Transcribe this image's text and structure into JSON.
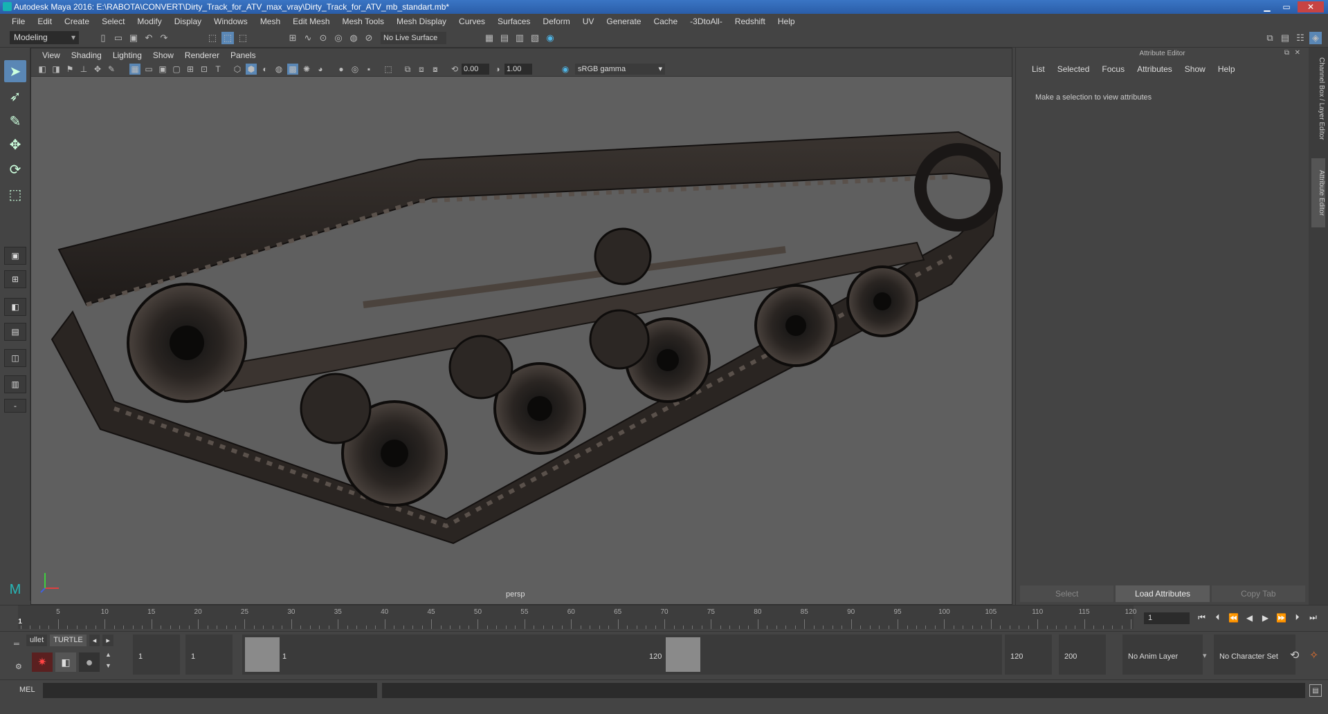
{
  "window": {
    "title": "Autodesk Maya 2016: E:\\RABOTA\\CONVERT\\Dirty_Track_for_ATV_max_vray\\Dirty_Track_for_ATV_mb_standart.mb*",
    "minimize": "▁",
    "maximize": "▭",
    "close": "✕"
  },
  "menubar": [
    "File",
    "Edit",
    "Create",
    "Select",
    "Modify",
    "Display",
    "Windows",
    "Mesh",
    "Edit Mesh",
    "Mesh Tools",
    "Mesh Display",
    "Curves",
    "Surfaces",
    "Deform",
    "UV",
    "Generate",
    "Cache",
    "-3DtoAll-",
    "Redshift",
    "Help"
  ],
  "statusline": {
    "mode": "Modeling",
    "live_surface": "No Live Surface"
  },
  "viewport": {
    "menus": [
      "View",
      "Shading",
      "Lighting",
      "Show",
      "Renderer",
      "Panels"
    ],
    "exposure": "0.00",
    "gamma": "1.00",
    "color_space": "sRGB gamma",
    "camera_label": "persp"
  },
  "attribute_editor": {
    "title": "Attribute Editor",
    "tabs": [
      "List",
      "Selected",
      "Focus",
      "Attributes",
      "Show",
      "Help"
    ],
    "message": "Make a selection to view attributes",
    "buttons": [
      "Select",
      "Load Attributes",
      "Copy Tab"
    ]
  },
  "side_tabs": [
    "Channel Box / Layer Editor",
    "Attribute Editor"
  ],
  "timeline": {
    "start_label": "1",
    "ticks": [
      5,
      10,
      15,
      20,
      25,
      30,
      35,
      40,
      45,
      50,
      55,
      60,
      65,
      70,
      75,
      80,
      85,
      90,
      95,
      100,
      105,
      110,
      115,
      120
    ],
    "current_frame": "1"
  },
  "range": {
    "shelf_tabs": [
      "ullet",
      "TURTLE"
    ],
    "start_time": "1",
    "playback_start": "1",
    "slider_start": "1",
    "slider_end": "120",
    "playback_end": "120",
    "end_time": "200",
    "anim_layer": "No Anim Layer",
    "character_set": "No Character Set"
  },
  "command_line": {
    "label": "MEL"
  }
}
